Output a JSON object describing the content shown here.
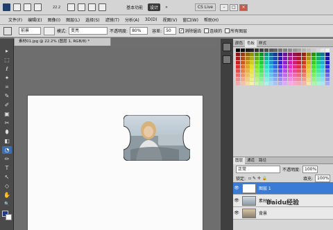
{
  "appbar": {
    "zoom": "22.2",
    "workspace_basic": "基本功能",
    "workspace_design": "设计",
    "chevrons": "»",
    "cslive": "CS Live",
    "win_min": "–",
    "win_max": "□",
    "win_close": "×"
  },
  "menu": {
    "items": [
      "文件(F)",
      "编辑(E)",
      "图像(I)",
      "图层(L)",
      "选择(S)",
      "滤镜(T)",
      "分析(A)",
      "3D(D)",
      "视图(V)",
      "窗口(W)",
      "帮助(H)"
    ]
  },
  "options": {
    "preset": "前景",
    "mode_label": "模式:",
    "mode_value": "变亮",
    "opacity_label": "不透明度:",
    "opacity_value": "80%",
    "tolerance_label": "容差:",
    "tolerance_value": "50",
    "antialias_label": "消除锯齿",
    "contiguous_label": "连续的",
    "alllayers_label": "所有图层"
  },
  "document": {
    "tab_title": "素材01.jpg @ 22.2% (图层 1, RGB/8) *"
  },
  "tools": {
    "glyphs": [
      "▸",
      "⬚",
      "ℓ",
      "✦",
      "⌗",
      "✎",
      "✐",
      "▣",
      "✂",
      "⬮",
      "◧",
      "◔",
      "✏",
      "T",
      "↖",
      "◇",
      "✋",
      "🔍",
      "⬛"
    ]
  },
  "panels": {
    "swatch_tabs": [
      "颜色",
      "色板",
      "样式"
    ],
    "layers_tabs": [
      "图层",
      "通道",
      "路径"
    ],
    "blend_mode": "正常",
    "opacity_label": "不透明度:",
    "opacity_value": "100%",
    "lock_label": "锁定:",
    "fill_label": "填充:",
    "fill_value": "100%",
    "layers": [
      {
        "name": "图层 1",
        "selected": true
      },
      {
        "name": "素材01",
        "selected": false
      },
      {
        "name": "背景",
        "selected": false
      }
    ]
  },
  "watermark": "Baidu经验",
  "colors": {
    "accent": "#3a7bd5",
    "panel": "#d1d1d1",
    "workspace": "#6e6e6e"
  }
}
